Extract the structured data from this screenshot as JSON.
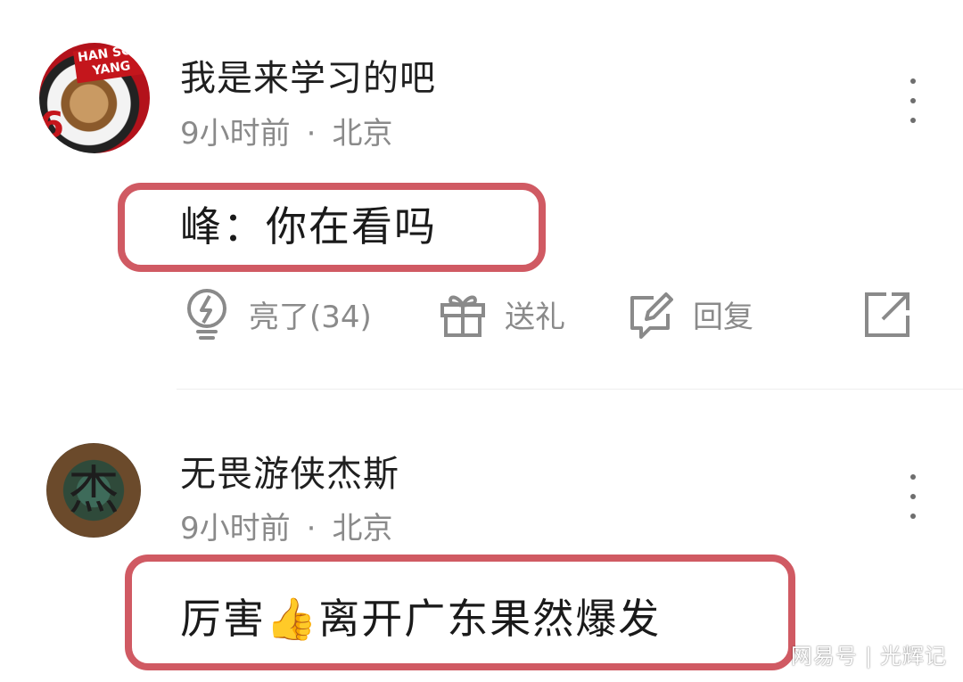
{
  "comments": [
    {
      "username": "我是来学习的吧",
      "time": "9小时前",
      "separator": "·",
      "location": "北京",
      "content": "峰：你在看吗",
      "avatar_badge": "HAN SCH YANG",
      "avatar_number": "6",
      "actions": {
        "like_label": "亮了(34)",
        "gift_label": "送礼",
        "reply_label": "回复"
      }
    },
    {
      "username": "无畏游侠杰斯",
      "time": "9小时前",
      "separator": "·",
      "location": "北京",
      "content": "厉害👍离开广东果然爆发",
      "avatar_mark": "杰"
    }
  ],
  "watermark": {
    "source": "网易号",
    "divider": "|",
    "author": "光辉记"
  },
  "colors": {
    "highlight_border": "#d05a63",
    "icon_gray": "#8a8a8a",
    "text_primary": "#1f1f1f"
  }
}
